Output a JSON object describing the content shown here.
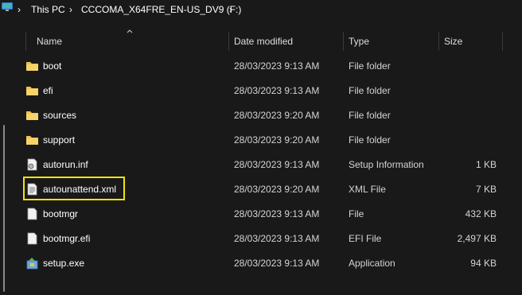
{
  "breadcrumb": {
    "items": [
      "This PC",
      "CCCOMA_X64FRE_EN-US_DV9 (F:)"
    ],
    "separator": "›"
  },
  "columns": {
    "name": "Name",
    "date": "Date modified",
    "type": "Type",
    "size": "Size"
  },
  "files": [
    {
      "name": "boot",
      "date": "28/03/2023 9:13 AM",
      "type": "File folder",
      "size": "",
      "icon": "folder-icon"
    },
    {
      "name": "efi",
      "date": "28/03/2023 9:13 AM",
      "type": "File folder",
      "size": "",
      "icon": "folder-icon"
    },
    {
      "name": "sources",
      "date": "28/03/2023 9:20 AM",
      "type": "File folder",
      "size": "",
      "icon": "folder-icon"
    },
    {
      "name": "support",
      "date": "28/03/2023 9:20 AM",
      "type": "File folder",
      "size": "",
      "icon": "folder-icon"
    },
    {
      "name": "autorun.inf",
      "date": "28/03/2023 9:13 AM",
      "type": "Setup Information",
      "size": "1 KB",
      "icon": "settings-file-icon"
    },
    {
      "name": "autounattend.xml",
      "date": "28/03/2023 9:20 AM",
      "type": "XML File",
      "size": "7 KB",
      "icon": "document-file-icon"
    },
    {
      "name": "bootmgr",
      "date": "28/03/2023 9:13 AM",
      "type": "File",
      "size": "432 KB",
      "icon": "blank-file-icon"
    },
    {
      "name": "bootmgr.efi",
      "date": "28/03/2023 9:13 AM",
      "type": "EFI File",
      "size": "2,497 KB",
      "icon": "blank-file-icon"
    },
    {
      "name": "setup.exe",
      "date": "28/03/2023 9:13 AM",
      "type": "Application",
      "size": "94 KB",
      "icon": "installer-icon"
    }
  ],
  "highlighted_file": "autounattend.xml",
  "colors": {
    "background": "#191919",
    "highlight_border": "#f2e40a",
    "folder": "#f0c24a"
  }
}
